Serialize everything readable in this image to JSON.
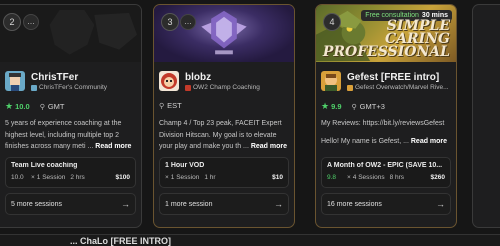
{
  "cards": [
    {
      "rank": "2",
      "name": "ChrisTFer",
      "community": "ChrisTFer's Community",
      "rating": "10.0",
      "timezone": "GMT",
      "bio": "5 years of experience coaching at the highest level, including multiple top 2 finishes across many meti ...",
      "read_more": "Read more",
      "offer": {
        "title": "Team Live coaching",
        "rating": "10.0",
        "sessions": "1 Session",
        "duration": "2 hrs",
        "price": "$100"
      },
      "more_sessions": "5 more sessions",
      "colors": {
        "avatar_bg": "#6aa9c7"
      }
    },
    {
      "rank": "3",
      "name": "blobz",
      "community": "OW2 Champ Coaching",
      "rating": "",
      "timezone": "EST",
      "bio": "Champ 4 / Top 23 peak, FACEIT Expert Division Hitscan. My goal is to elevate your play and make you th ...",
      "read_more": "Read more",
      "offer": {
        "title": "1 Hour VOD",
        "rating": "",
        "sessions": "1 Session",
        "duration": "1 hr",
        "price": "$10"
      },
      "more_sessions": "1 more session",
      "colors": {
        "avatar_bg": "#c23a2a"
      }
    },
    {
      "rank": "4",
      "name": "Gefest [FREE intro]",
      "community": "Gefest Overwatch/Marvel Rive...",
      "rating": "9.9",
      "timezone": "GMT+3",
      "bio": "My Reviews: https://bit.ly/reviewsGefest",
      "bio2": "Hello! My name is Gefest, ...",
      "read_more": "Read more",
      "free_badge": {
        "label": "Free consultation",
        "duration": "30 mins"
      },
      "banner_text": "SIMPLE CARING PROFESSIONAL",
      "offer": {
        "title": "A Month of OW2 - EPIC (SAVE 10...",
        "rating": "9.8",
        "sessions": "4 Sessions",
        "duration": "8 hrs",
        "price": "$260"
      },
      "more_sessions": "16 more sessions",
      "colors": {
        "avatar_bg": "#d9a03a"
      }
    }
  ],
  "ui": {
    "more_indicator": "...",
    "x_mark": "×",
    "arrow": "→",
    "star": "★",
    "pin": "⚲"
  },
  "bottom_text": "... ChaLo [FREE INTRO]",
  "colors": {
    "accent_green": "#4fd16a",
    "border_gold": "#6a5430"
  }
}
